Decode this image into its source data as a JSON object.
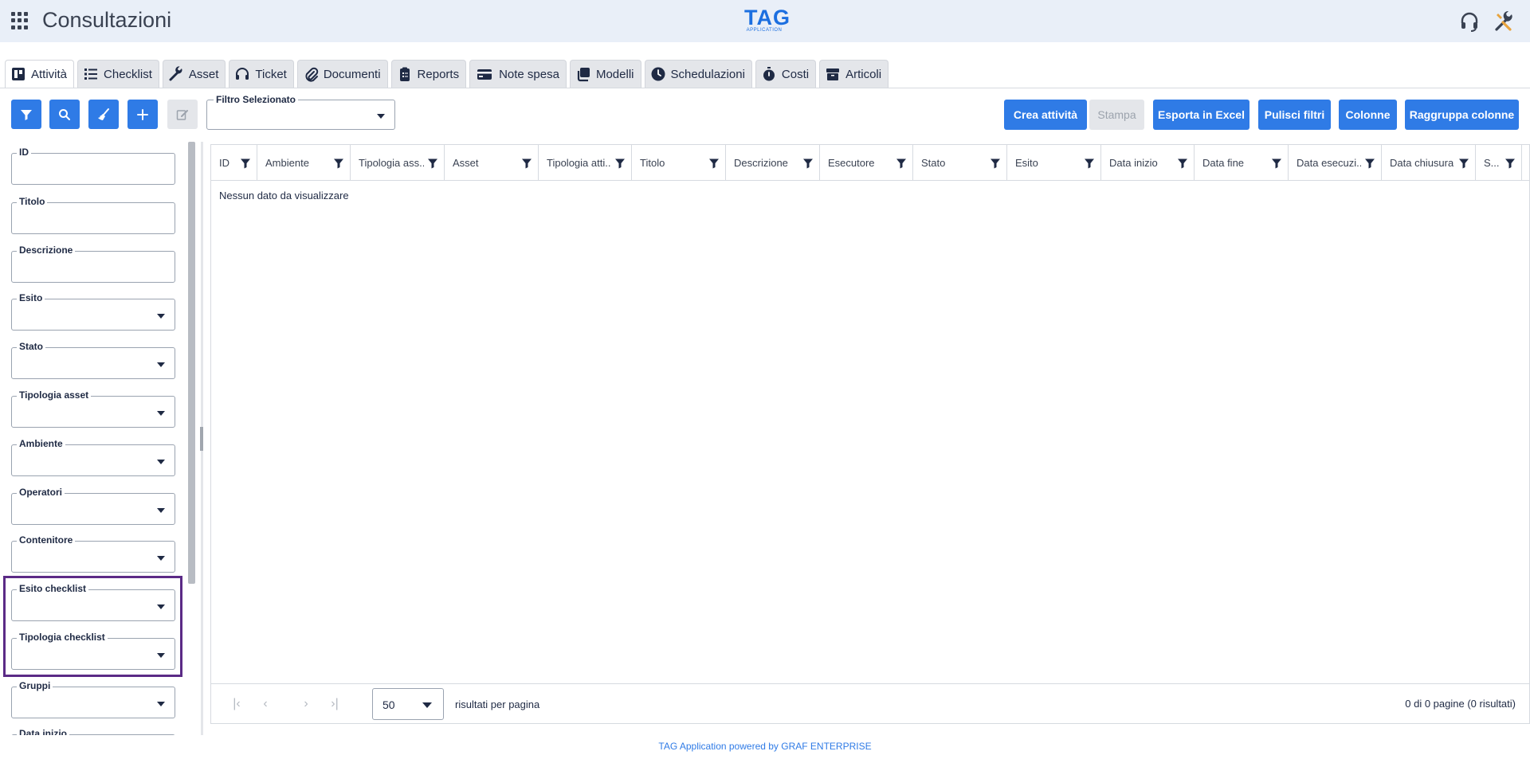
{
  "header": {
    "title": "Consultazioni",
    "logo_main": "TAG",
    "logo_sub": "APPLICATION",
    "icons": [
      "apps-grid-icon",
      "headset-support-icon",
      "tools-icon"
    ]
  },
  "tabs": [
    {
      "label": "Attività",
      "icon": "board-icon",
      "active": true
    },
    {
      "label": "Checklist",
      "icon": "list-icon"
    },
    {
      "label": "Asset",
      "icon": "wrench-icon"
    },
    {
      "label": "Ticket",
      "icon": "headset-icon"
    },
    {
      "label": "Documenti",
      "icon": "paperclip-icon"
    },
    {
      "label": "Reports",
      "icon": "clipboard-icon"
    },
    {
      "label": "Note spesa",
      "icon": "credit-card-icon"
    },
    {
      "label": "Modelli",
      "icon": "copy-icon"
    },
    {
      "label": "Schedulazioni",
      "icon": "clock-icon"
    },
    {
      "label": "Costi",
      "icon": "stopwatch-icon"
    },
    {
      "label": "Articoli",
      "icon": "box-icon"
    }
  ],
  "toolbar": {
    "filter_select_label": "Filtro Selezionato",
    "filter_select_value": "",
    "actions": {
      "create": "Crea attività",
      "print": "Stampa",
      "export": "Esporta in Excel",
      "clear": "Pulisci filtri",
      "columns": "Colonne",
      "group": "Raggruppa colonne"
    }
  },
  "filters": {
    "id": "ID",
    "titolo": "Titolo",
    "descrizione": "Descrizione",
    "esito": "Esito",
    "stato": "Stato",
    "tipologia_asset": "Tipologia asset",
    "ambiente": "Ambiente",
    "operatori": "Operatori",
    "contenitore": "Contenitore",
    "esito_checklist": "Esito checklist",
    "tipologia_checklist": "Tipologia checklist",
    "gruppi": "Gruppi",
    "data_inizio": "Data inizio"
  },
  "grid": {
    "columns": [
      "ID",
      "Ambiente",
      "Tipologia ass...",
      "Asset",
      "Tipologia atti...",
      "Titolo",
      "Descrizione",
      "Esecutore",
      "Stato",
      "Esito",
      "Data inizio",
      "Data fine",
      "Data esecuzi...",
      "Data chiusura",
      "S..."
    ],
    "empty_message": "Nessun dato da visualizzare",
    "page_size": "50",
    "page_size_label": "risultati per pagina",
    "page_info": "0 di 0 pagine (0 risultati)",
    "nav": {
      "first": "|‹",
      "prev": "‹",
      "next": "›",
      "last": "›|"
    }
  },
  "footer": "TAG Application powered by GRAF ENTERPRISE",
  "colors": {
    "primary": "#2f7be6",
    "header_bg": "#e9eff8",
    "highlight": "#5b2a86"
  }
}
